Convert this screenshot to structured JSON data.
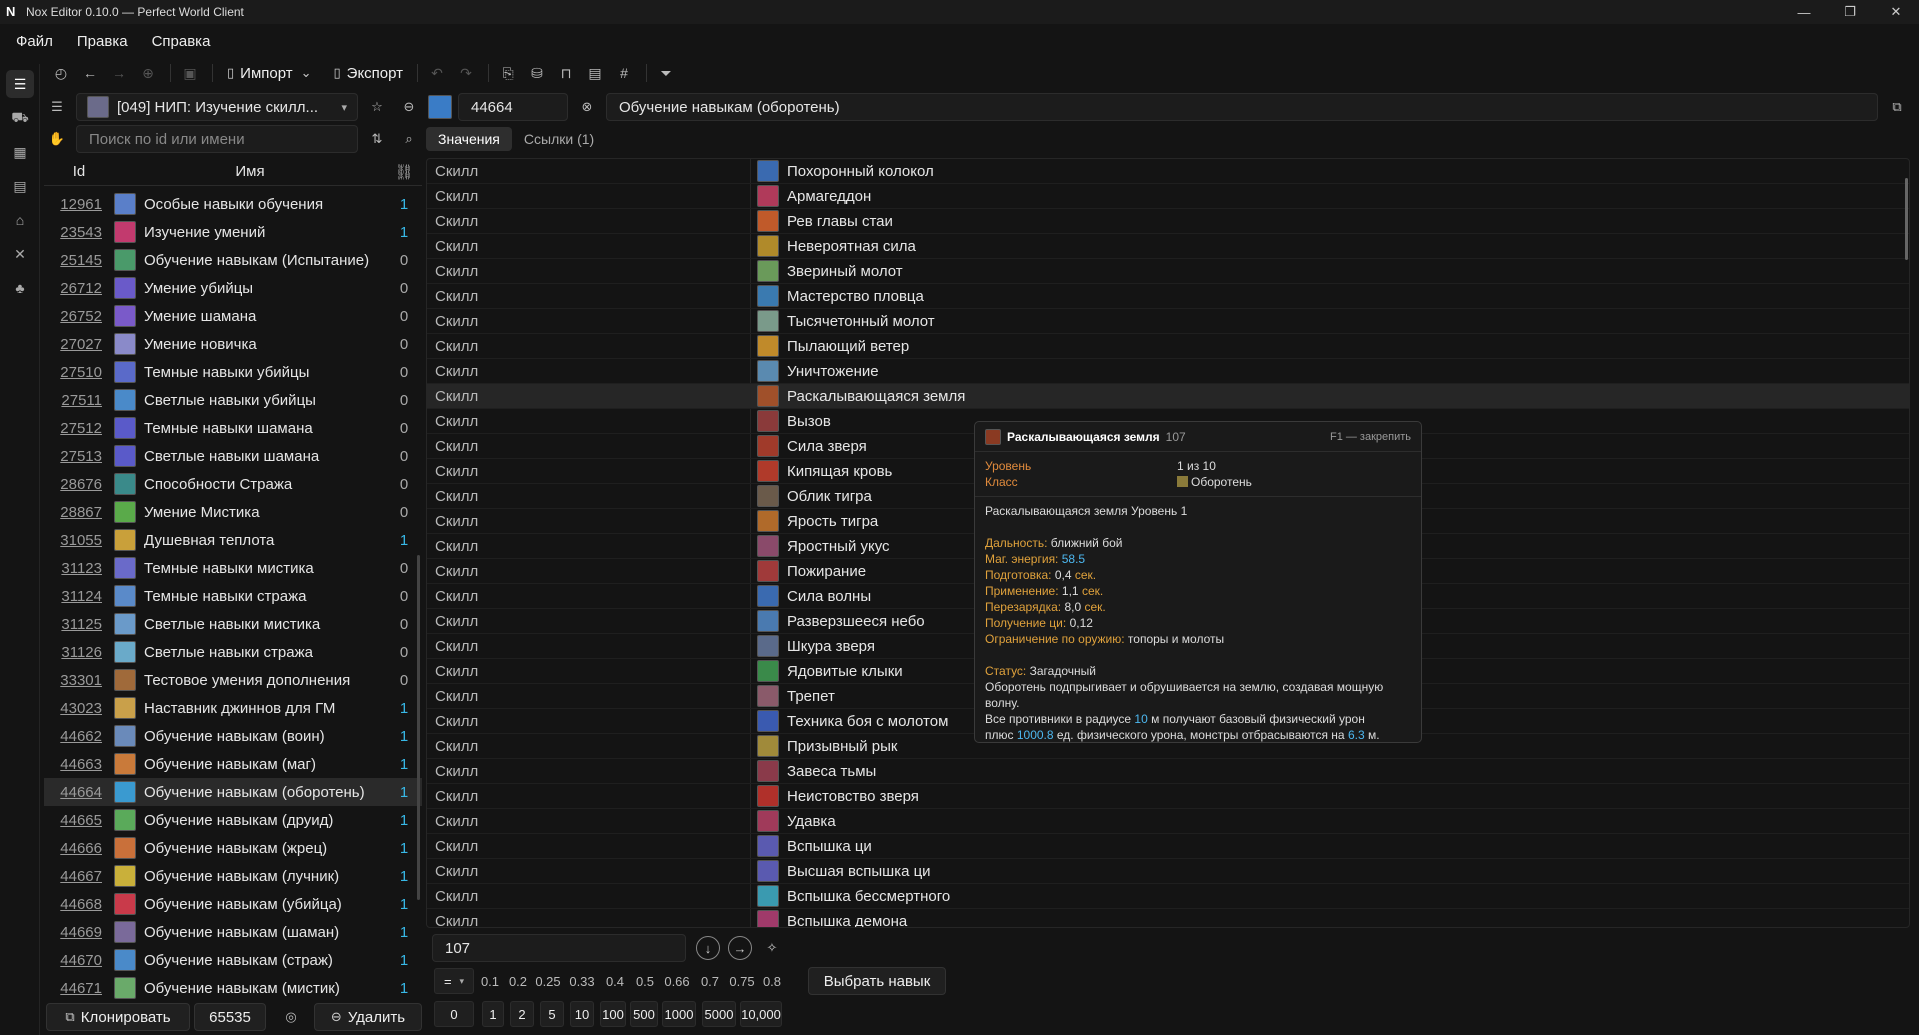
{
  "window": {
    "title": "Nox Editor 0.10.0 — Perfect World Client",
    "logo": "N"
  },
  "menu": [
    "Файл",
    "Правка",
    "Справка"
  ],
  "toolbar": {
    "import_label": "Импорт",
    "export_label": "Экспорт"
  },
  "list_selector": {
    "label": "[049] НИП: Изучение скилл..."
  },
  "search": {
    "placeholder": "Поиск по id или имени"
  },
  "record": {
    "id": "44664",
    "name": "Обучение навыкам (оборотень)"
  },
  "tabs": [
    "Значения",
    "Ссылки (1)"
  ],
  "list": {
    "columns": {
      "id": "Id",
      "name": "Имя"
    },
    "rows": [
      {
        "id": "12961",
        "name": "Особые навыки обучения",
        "count": "1"
      },
      {
        "id": "23543",
        "name": "Изучение умений",
        "count": "1"
      },
      {
        "id": "25145",
        "name": "Обучение навыкам (Испытание)",
        "count": "0"
      },
      {
        "id": "26712",
        "name": "Умение убийцы",
        "count": "0"
      },
      {
        "id": "26752",
        "name": "Умение шамана",
        "count": "0"
      },
      {
        "id": "27027",
        "name": "Умение новичка",
        "count": "0"
      },
      {
        "id": "27510",
        "name": "Темные навыки убийцы",
        "count": "0"
      },
      {
        "id": "27511",
        "name": "Светлые навыки убийцы",
        "count": "0"
      },
      {
        "id": "27512",
        "name": "Темные навыки шамана",
        "count": "0"
      },
      {
        "id": "27513",
        "name": "Светлые навыки шамана",
        "count": "0"
      },
      {
        "id": "28676",
        "name": "Способности Стража",
        "count": "0"
      },
      {
        "id": "28867",
        "name": "Умение Мистика",
        "count": "0"
      },
      {
        "id": "31055",
        "name": "Душевная теплота",
        "count": "1"
      },
      {
        "id": "31123",
        "name": "Темные навыки мистика",
        "count": "0"
      },
      {
        "id": "31124",
        "name": "Темные навыки стража",
        "count": "0"
      },
      {
        "id": "31125",
        "name": "Светлые навыки мистика",
        "count": "0"
      },
      {
        "id": "31126",
        "name": "Светлые навыки стража",
        "count": "0"
      },
      {
        "id": "33301",
        "name": "Тестовое умения дополнения",
        "count": "0"
      },
      {
        "id": "43023",
        "name": "Наставник джиннов для ГМ",
        "count": "1"
      },
      {
        "id": "44662",
        "name": "Обучение навыкам (воин)",
        "count": "1"
      },
      {
        "id": "44663",
        "name": "Обучение навыкам (маг)",
        "count": "1"
      },
      {
        "id": "44664",
        "name": "Обучение навыкам (оборотень)",
        "count": "1"
      },
      {
        "id": "44665",
        "name": "Обучение навыкам (друид)",
        "count": "1"
      },
      {
        "id": "44666",
        "name": "Обучение навыкам (жрец)",
        "count": "1"
      },
      {
        "id": "44667",
        "name": "Обучение навыкам (лучник)",
        "count": "1"
      },
      {
        "id": "44668",
        "name": "Обучение навыкам (убийца)",
        "count": "1"
      },
      {
        "id": "44669",
        "name": "Обучение навыкам (шаман)",
        "count": "1"
      },
      {
        "id": "44670",
        "name": "Обучение навыкам (страж)",
        "count": "1"
      },
      {
        "id": "44671",
        "name": "Обучение навыкам (мистик)",
        "count": "1"
      }
    ],
    "selected_id": "44664"
  },
  "left_footer": {
    "clone_label": "Клонировать",
    "count_value": "65535",
    "delete_label": "Удалить"
  },
  "values": {
    "key_label": "Скилл",
    "skills": [
      "Похоронный колокол",
      "Армагеддон",
      "Рев главы стаи",
      "Невероятная сила",
      "Звериный молот",
      "Мастерство пловца",
      "Тысячетонный молот",
      "Пылающий ветер",
      "Уничтожение",
      "Раскалывающаяся земля",
      "Вызов",
      "Сила зверя",
      "Кипящая кровь",
      "Облик тигра",
      "Ярость тигра",
      "Яростный укус",
      "Пожирание",
      "Сила волны",
      "Разверзшееся небо",
      "Шкура зверя",
      "Ядовитые клыки",
      "Трепет",
      "Техника боя с молотом",
      "Призывный рык",
      "Завеса тьмы",
      "Неистовство зверя",
      "Удавка",
      "Вспышка ци",
      "Высшая вспышка ци",
      "Вспышка бессмертного",
      "Вспышка демона"
    ],
    "highlight_index": 9
  },
  "tooltip": {
    "title": "Раскалывающаяся земля",
    "id": "107",
    "hint": "F1 — закрепить",
    "level_label": "Уровень",
    "level_value": "1 из 10",
    "class_label": "Класс",
    "class_value": "Оборотень",
    "subtitle": "Раскалывающаяся земля Уровень 1",
    "range_label": "Дальность:",
    "range_value": "ближний бой",
    "mp_label": "Маг. энергия:",
    "mp_value": "58.5",
    "prep_label": "Подготовка:",
    "prep_value": "0,4",
    "sec": "сек.",
    "cast_label": "Применение:",
    "cast_value": "1,1",
    "cd_label": "Перезарядка:",
    "cd_value": "8,0",
    "chi_label": "Получение ци:",
    "chi_value": "0,12",
    "weapon_label": "Ограничение по оружию:",
    "weapon_value": "топоры и молоты",
    "status_label": "Статус:",
    "status_value": "Загадочный",
    "desc1": "Оборотень подпрыгивает и обрушивается на землю, создавая мощную волну.",
    "desc2_a": "Все противники в радиусе ",
    "desc2_radius": "10",
    "desc2_b": " м получают базовый физический урон",
    "desc3_a": "плюс ",
    "desc3_dmg": "1000.8",
    "desc3_b": " ед. физического урона, монстры отбрасываются на ",
    "desc3_dist": "6.3",
    "desc3_c": " м."
  },
  "editor": {
    "value": "107",
    "op": "=",
    "steps": [
      "0.1",
      "0.2",
      "0.25",
      "0.33",
      "0.4",
      "0.5",
      "0.66",
      "0.7",
      "0.75",
      "0.8"
    ],
    "presets": [
      "0",
      "1",
      "2",
      "5",
      "10",
      "100",
      "500",
      "1000",
      "5000",
      "10,000"
    ],
    "pick_label": "Выбрать навык"
  }
}
